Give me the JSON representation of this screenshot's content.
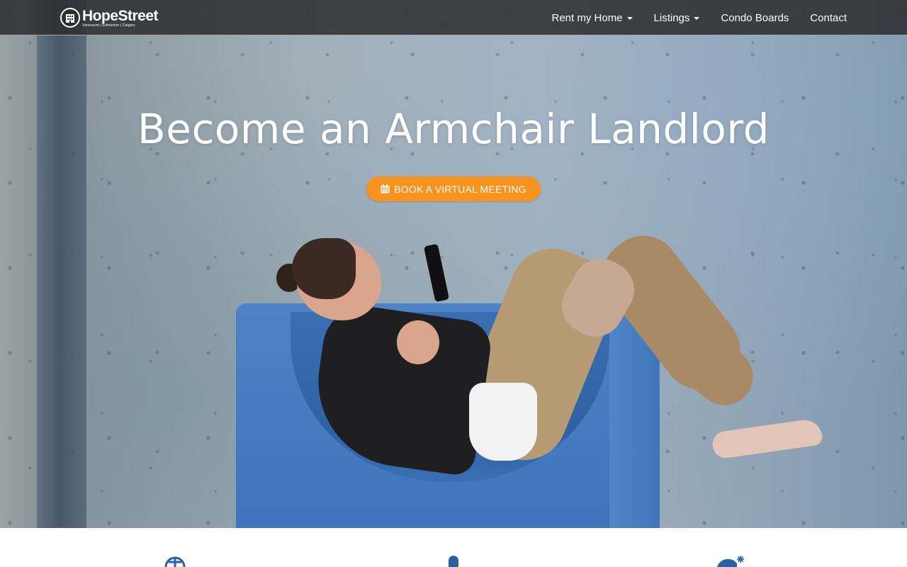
{
  "brand": {
    "name": "HopeStreet",
    "tagline": "Vancouver | Edmonton | Calgary"
  },
  "nav": {
    "items": [
      {
        "label": "Rent my Home",
        "dropdown": true
      },
      {
        "label": "Listings",
        "dropdown": true
      },
      {
        "label": "Condo Boards",
        "dropdown": false
      },
      {
        "label": "Contact",
        "dropdown": false
      }
    ]
  },
  "hero": {
    "title": "Become an Armchair Landlord",
    "cta_label": "BOOK A VIRTUAL MEETING",
    "cta_icon": "calendar-icon"
  },
  "features": {
    "icons": [
      "globe-icon",
      "person-icon",
      "bomb-icon"
    ]
  },
  "colors": {
    "accent": "#f7931e",
    "nav_bg": "#2d2f32",
    "icon_blue": "#2b5fa8"
  }
}
